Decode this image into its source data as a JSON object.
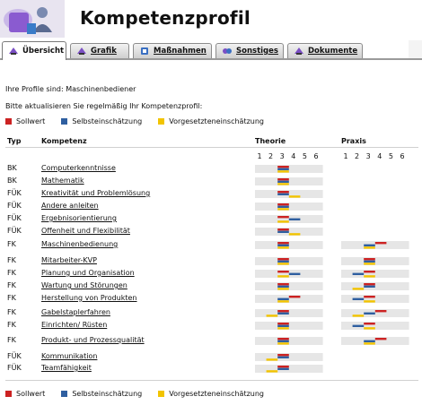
{
  "app": {
    "title": "Kompetenzprofil"
  },
  "tabs": [
    {
      "label": "Übersicht",
      "active": true,
      "icon": "overview-icon"
    },
    {
      "label": "Grafik",
      "active": false,
      "icon": "graphic-icon"
    },
    {
      "label": "Maßnahmen",
      "active": false,
      "icon": "measures-icon"
    },
    {
      "label": "Sonstiges",
      "active": false,
      "icon": "misc-icon"
    },
    {
      "label": "Dokumente",
      "active": false,
      "icon": "documents-icon"
    }
  ],
  "intro": {
    "profiles": "Ihre Profile sind: Maschinenbediener",
    "update_hint": "Bitte aktualisieren Sie regelmäßig Ihr Kompetenzprofil:"
  },
  "legend": [
    {
      "label": "Sollwert",
      "color": "#cc2222"
    },
    {
      "label": "Selbsteinschätzung",
      "color": "#2f5fa0"
    },
    {
      "label": "Vorgesetzteneinschätzung",
      "color": "#f2c400"
    }
  ],
  "table": {
    "headers": {
      "typ": "Typ",
      "kompetenz": "Kompetenz",
      "theorie": "Theorie",
      "praxis": "Praxis"
    },
    "scale": [
      "1",
      "2",
      "3",
      "4",
      "5",
      "6"
    ],
    "rows": [
      {
        "typ": "BK",
        "name": "Computerkenntnisse",
        "theorie": [
          3,
          3,
          3
        ],
        "praxis": null
      },
      {
        "typ": "BK",
        "name": "Mathematik",
        "theorie": [
          3,
          3,
          3
        ],
        "praxis": null
      },
      {
        "typ": "FÜK",
        "name": "Kreativität und Problemlösung",
        "theorie": [
          3,
          3,
          4
        ],
        "praxis": null
      },
      {
        "typ": "FÜK",
        "name": "Andere anleiten",
        "theorie": [
          3,
          3,
          3
        ],
        "praxis": null
      },
      {
        "typ": "FÜK",
        "name": "Ergebnisorientierung",
        "theorie": [
          3,
          4,
          3
        ],
        "praxis": null
      },
      {
        "typ": "FÜK",
        "name": "Offenheit und Flexibilität",
        "theorie": [
          3,
          3,
          4
        ],
        "praxis": null
      },
      {
        "typ": "FK",
        "name": "Maschinenbedienung",
        "theorie": [
          3,
          3,
          3
        ],
        "praxis": [
          4,
          3,
          3
        ]
      },
      {
        "typ": "FK",
        "name": "Mitarbeiter-KVP",
        "theorie": [
          3,
          3,
          3
        ],
        "praxis": [
          3,
          3,
          3
        ]
      },
      {
        "typ": "FK",
        "name": "Planung und Organisation",
        "theorie": [
          3,
          4,
          3
        ],
        "praxis": [
          3,
          2,
          3
        ]
      },
      {
        "typ": "FK",
        "name": "Wartung und Störungen",
        "theorie": [
          3,
          3,
          3
        ],
        "praxis": [
          3,
          3,
          2
        ]
      },
      {
        "typ": "FK",
        "name": "Herstellung von Produkten",
        "theorie": [
          4,
          3,
          3
        ],
        "praxis": [
          3,
          2,
          3
        ]
      },
      {
        "typ": "FK",
        "name": "Gabelstaplerfahren",
        "theorie": [
          3,
          3,
          2
        ],
        "praxis": [
          4,
          3,
          2
        ]
      },
      {
        "typ": "FK",
        "name": "Einrichten/ Rüsten",
        "theorie": [
          3,
          3,
          3
        ],
        "praxis": [
          3,
          2,
          3
        ]
      },
      {
        "typ": "FK",
        "name": "Produkt- und Prozessqualität",
        "theorie": [
          3,
          3,
          3
        ],
        "praxis": [
          4,
          3,
          3
        ]
      },
      {
        "typ": "FÜK",
        "name": "Kommunikation",
        "theorie": [
          3,
          3,
          2
        ],
        "praxis": null
      },
      {
        "typ": "FÜK",
        "name": "Teamfähigkeit",
        "theorie": [
          3,
          3,
          2
        ],
        "praxis": null
      }
    ]
  }
}
